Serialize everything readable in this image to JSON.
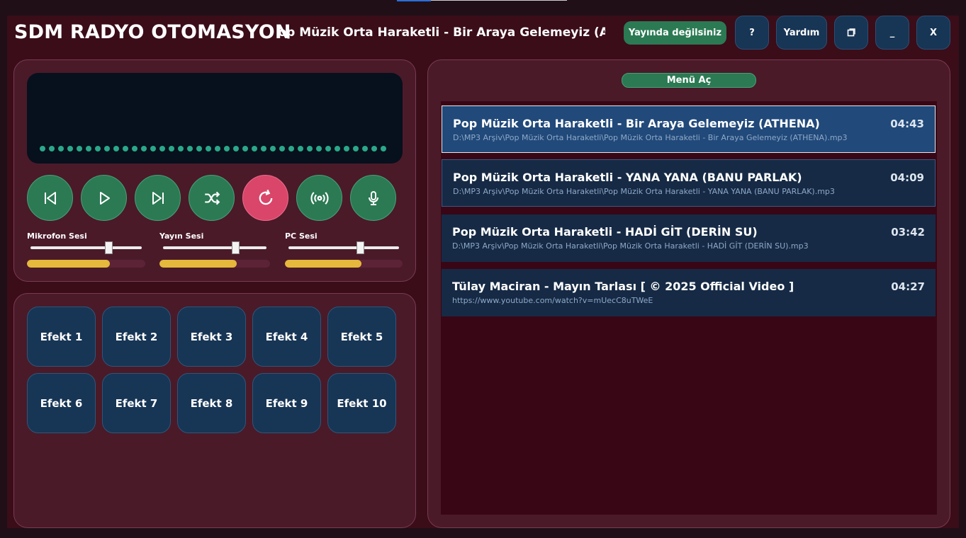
{
  "app": {
    "title": "SDM RADYO OTOMASYON"
  },
  "now_playing": {
    "marquee": "Pop Müzik Orta Haraketli - Bir Araya Gelemeyiz (ATHENA)"
  },
  "header": {
    "status_label": "Yayında değilsiniz",
    "help_q_label": "?",
    "help_label": "Yardım",
    "minimize_label": "_",
    "close_label": "X"
  },
  "controls": {
    "icons": [
      "previous-icon",
      "play-icon",
      "next-icon",
      "shuffle-icon",
      "repeat-icon",
      "broadcast-icon",
      "microphone-icon"
    ]
  },
  "sliders": [
    {
      "label": "Mikrofon Sesi",
      "value": 0.7,
      "level": 0.7
    },
    {
      "label": "Yayın Sesi",
      "value": 0.7,
      "level": 0.7
    },
    {
      "label": "PC Sesi",
      "value": 0.65,
      "level": 0.65
    }
  ],
  "effects": [
    "Efekt 1",
    "Efekt 2",
    "Efekt 3",
    "Efekt 4",
    "Efekt 5",
    "Efekt 6",
    "Efekt 7",
    "Efekt 8",
    "Efekt 9",
    "Efekt 10"
  ],
  "menu": {
    "label": "Menü Aç"
  },
  "playlist": [
    {
      "title": "Pop Müzik Orta Haraketli - Bir Araya Gelemeyiz (ATHENA)",
      "duration": "04:43",
      "path": "D:\\MP3 Arşiv\\Pop Müzik Orta Haraketli\\Pop Müzik Orta Haraketli - Bir Araya Gelemeyiz (ATHENA).mp3"
    },
    {
      "title": "Pop Müzik Orta Haraketli - YANA YANA (BANU PARLAK)",
      "duration": "04:09",
      "path": "D:\\MP3 Arşiv\\Pop Müzik Orta Haraketli\\Pop Müzik Orta Haraketli - YANA YANA (BANU PARLAK).mp3"
    },
    {
      "title": "Pop Müzik Orta Haraketli - HADİ GİT (DERİN SU)",
      "duration": "03:42",
      "path": "D:\\MP3 Arşiv\\Pop Müzik Orta Haraketli\\Pop Müzik Orta Haraketli - HADİ GİT (DERİN SU).mp3"
    },
    {
      "title": "Tülay Maciran - Mayın Tarlası [ © 2025 Official Video ]",
      "duration": "04:27",
      "path": "https://www.youtube.com/watch?v=mUecC8uTWeE"
    }
  ],
  "colors": {
    "accent_green": "#2b7a53",
    "accent_red": "#d9466a",
    "level_yellow": "#e6b83c",
    "selection_blue": "#21497a"
  }
}
